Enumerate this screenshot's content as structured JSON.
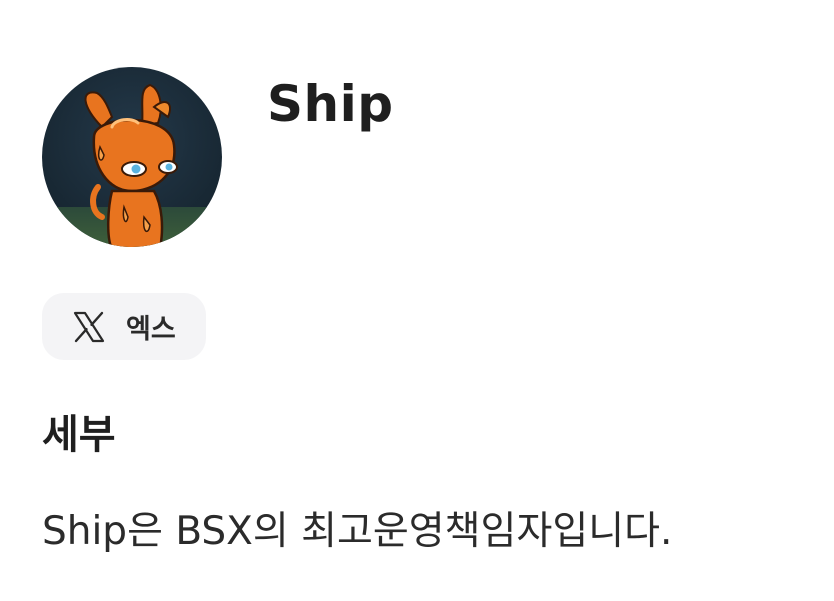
{
  "profile": {
    "name": "Ship",
    "avatar_icon": "orange-creature-avatar"
  },
  "socials": [
    {
      "icon": "x-logo-icon",
      "label": "엑스"
    }
  ],
  "details": {
    "heading": "세부",
    "body": "Ship은 BSX의 최고운영책임자입니다."
  },
  "colors": {
    "avatar_background": "#1c2e3a",
    "avatar_figure": "#e8741f",
    "chip_background": "#f4f4f6",
    "text": "#1f1f1f"
  }
}
